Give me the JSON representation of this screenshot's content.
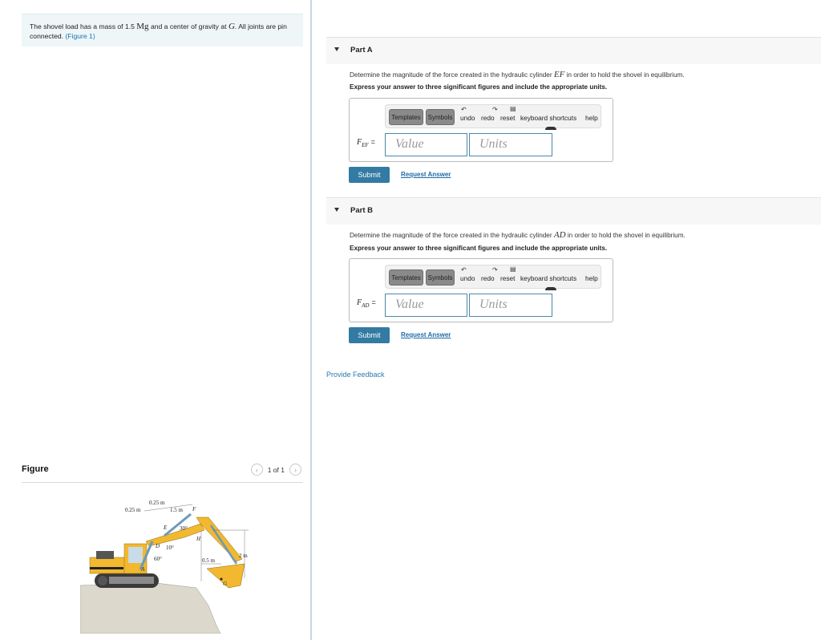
{
  "problem": {
    "text_before_mass": "The shovel load has a mass of 1.5 ",
    "mass_unit": "Mg",
    "text_middle": " and a center of gravity at ",
    "cog_symbol": "G",
    "text_after": ". All joints are pin connected. ",
    "figure_link": "(Figure 1)"
  },
  "figure": {
    "title": "Figure",
    "pager": "1 of 1",
    "prev_icon": "chevron-left-icon",
    "next_icon": "chevron-right-icon",
    "labels": {
      "dim_025_left": "0.25 m",
      "dim_025_top": "0.25 m",
      "dim_15": "1.5 m",
      "F": "F",
      "E": "E",
      "angle_30": "30°",
      "H": "H",
      "D": "D",
      "angle_10": "10°",
      "angle_60": "60°",
      "A": "A",
      "dim_05": "0.5 m",
      "dim_2": "2 m",
      "G": "G"
    },
    "colors": {
      "excavator_body": "#f2b830",
      "cylinders": "#6c9ab8",
      "ground": "#d8d4c8",
      "tracks": "#3a3a3a"
    }
  },
  "parts": [
    {
      "title": "Part A",
      "question_before": "Determine the magnitude of the force created in the hydraulic cylinder ",
      "question_symbol": "EF",
      "question_after": " in order to hold the shovel in equilibrium.",
      "instruction": "Express your answer to three significant figures and include the appropriate units.",
      "variable": "F",
      "variable_sub": "EF",
      "equals": "=",
      "value_placeholder": "Value",
      "units_placeholder": "Units",
      "submit_label": "Submit",
      "request_label": "Request Answer"
    },
    {
      "title": "Part B",
      "question_before": "Determine the magnitude of the force created in the hydraulic cylinder ",
      "question_symbol": "AD",
      "question_after": " in order to hold the shovel in equilibrium.",
      "instruction": "Express your answer to three significant figures and include the appropriate units.",
      "variable": "F",
      "variable_sub": "AD",
      "equals": "=",
      "value_placeholder": "Value",
      "units_placeholder": "Units",
      "submit_label": "Submit",
      "request_label": "Request Answer"
    }
  ],
  "toolbar": {
    "templates": "Templates",
    "symbols": "Symbols",
    "undo": "undo",
    "redo": "redo",
    "reset": "reset",
    "keyboard_shortcuts": "keyboard shortcuts",
    "help": "help"
  },
  "feedback_link": "Provide Feedback",
  "colors": {
    "accent": "#337ba2",
    "link": "#1a74b5",
    "problem_bg": "#eef6f8"
  }
}
